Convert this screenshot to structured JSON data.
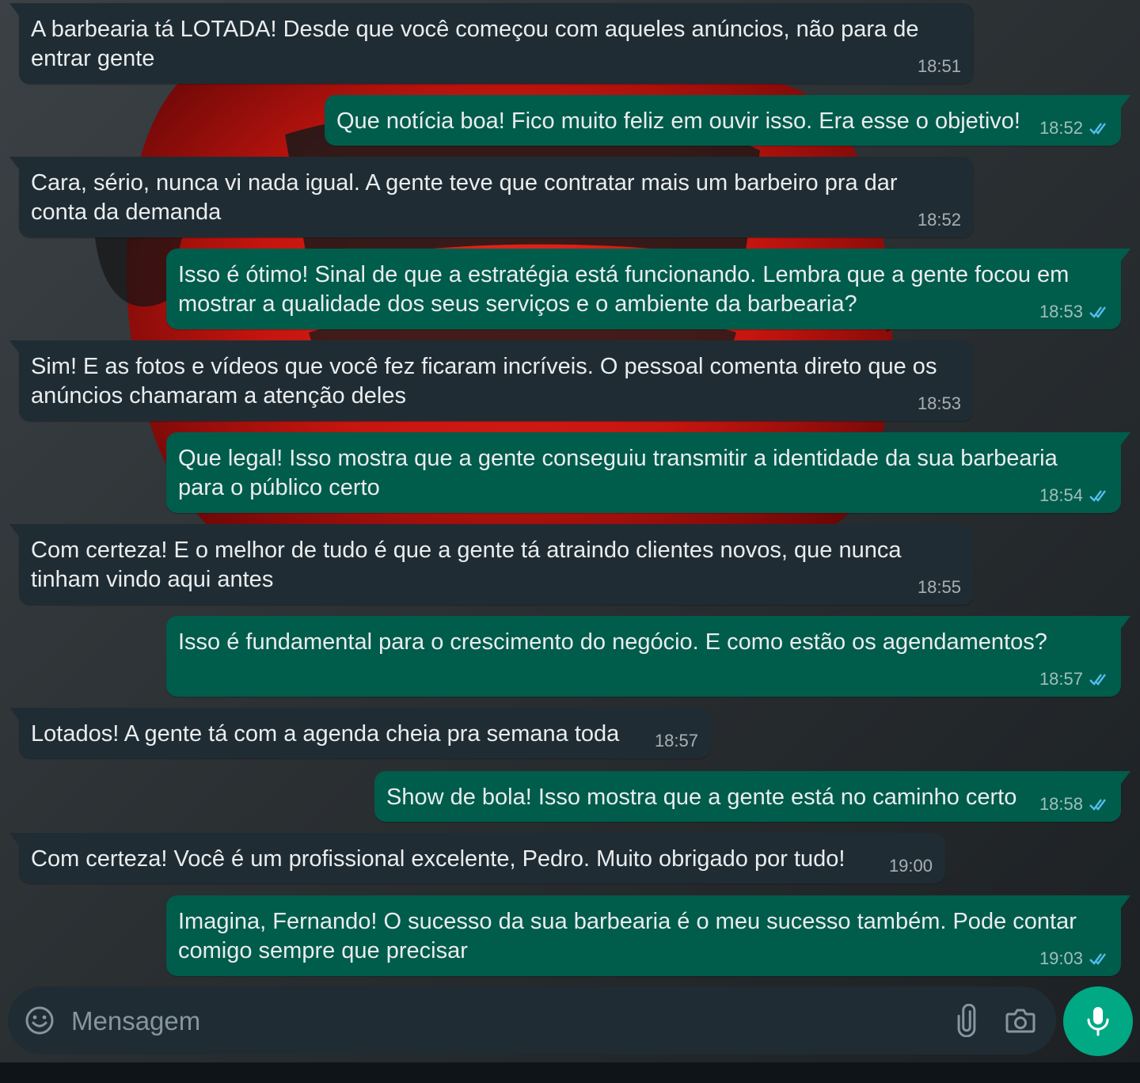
{
  "chat": {
    "messages": [
      {
        "direction": "in",
        "text": "A barbearia tá LOTADA! Desde que você começou com aqueles anúncios, não para de\nentrar gente",
        "time": "18:51"
      },
      {
        "direction": "out",
        "text": "Que notícia boa! Fico muito feliz em ouvir isso. Era esse o objetivo!",
        "time": "18:52",
        "status": "read"
      },
      {
        "direction": "in",
        "text": "Cara, sério, nunca vi nada igual. A gente teve que contratar mais um barbeiro pra dar\nconta da demanda",
        "time": "18:52"
      },
      {
        "direction": "out",
        "text": "Isso é ótimo! Sinal de que a estratégia está funcionando. Lembra que a gente focou em\nmostrar a qualidade dos seus serviços e o ambiente da barbearia?",
        "time": "18:53",
        "status": "read"
      },
      {
        "direction": "in",
        "text": "Sim! E as fotos e vídeos que você fez ficaram incríveis. O pessoal comenta direto que os\nanúncios chamaram a atenção deles",
        "time": "18:53"
      },
      {
        "direction": "out",
        "text": "Que legal! Isso mostra que a gente conseguiu transmitir a identidade da sua barbearia\npara o público certo",
        "time": "18:54",
        "status": "read"
      },
      {
        "direction": "in",
        "text": "Com certeza! E o melhor de tudo é que a gente tá atraindo clientes novos, que nunca\ntinham vindo aqui antes",
        "time": "18:55"
      },
      {
        "direction": "out",
        "text": "Isso é fundamental para o crescimento do negócio. E como estão os agendamentos?",
        "time": "18:57",
        "status": "read"
      },
      {
        "direction": "in",
        "text": "Lotados! A gente tá com a agenda cheia pra semana toda",
        "time": "18:57"
      },
      {
        "direction": "out",
        "text": "Show de bola! Isso mostra que a gente está no caminho certo",
        "time": "18:58",
        "status": "read"
      },
      {
        "direction": "in",
        "text": "Com certeza! Você é um profissional excelente, Pedro. Muito obrigado por tudo!",
        "time": "19:00"
      },
      {
        "direction": "out",
        "text": "Imagina, Fernando! O sucesso da sua barbearia é o meu sucesso também. Pode contar\ncomigo sempre que precisar",
        "time": "19:03",
        "status": "read"
      }
    ]
  },
  "composer": {
    "placeholder": "Mensagem",
    "emoji_icon": "emoji-icon",
    "attach_icon": "paperclip-icon",
    "camera_icon": "camera-icon",
    "mic_icon": "microphone-icon"
  },
  "colors": {
    "incoming_bubble": "#202c33",
    "outgoing_bubble": "#005c4b",
    "accent": "#00a884",
    "read_ticks": "#53bdeb"
  }
}
